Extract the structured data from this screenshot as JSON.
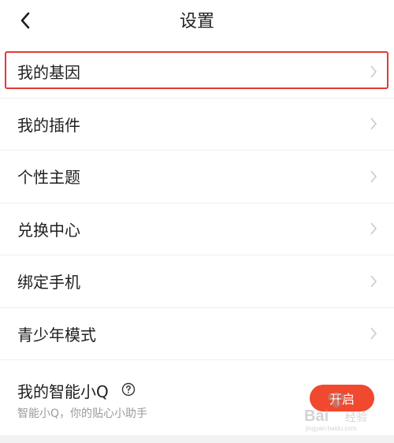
{
  "header": {
    "title": "设置",
    "back_icon": "chevron-left-icon"
  },
  "menu": {
    "items": [
      {
        "label": "我的基因",
        "highlighted": true
      },
      {
        "label": "我的插件"
      },
      {
        "label": "个性主题"
      },
      {
        "label": "兑换中心"
      },
      {
        "label": "绑定手机"
      },
      {
        "label": "青少年模式"
      }
    ]
  },
  "assistant": {
    "title": "我的智能小Q",
    "subtitle": "智能小Q，你的贴心小助手",
    "button_label": "开启",
    "help_icon": "question-circle-icon"
  },
  "watermark": {
    "text": "Baidu 经验",
    "url_text": "jingyan.baidu.com"
  },
  "colors": {
    "accent": "#f0492f",
    "highlight_border": "#e53935",
    "chevron": "#c8c8c8"
  }
}
